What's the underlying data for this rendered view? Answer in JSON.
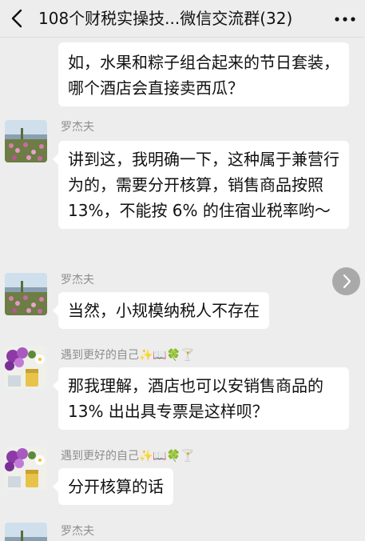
{
  "header": {
    "title": "108个财税实操技...微信交流群(32)",
    "back_icon": "chevron-left-icon",
    "more_icon": "ellipsis-icon"
  },
  "messages": [
    {
      "sender": "",
      "text": "如，水果和粽子组合起来的节日套装，哪个酒店会直接卖西瓜？",
      "avatar": ""
    },
    {
      "sender": "罗杰夫",
      "text": "讲到这，我明确一下，这种属于兼营行为的，需要分开核算，销售商品按照 13%，不能按 6% 的住宿业税率哟～",
      "avatar": "field-photo-avatar"
    },
    {
      "sender": "罗杰夫",
      "text": "当然，小规模纳税人不存在",
      "avatar": "field-photo-avatar"
    },
    {
      "sender": "遇到更好的自己✨📖🍀🍸",
      "text": "那我理解，酒店也可以安销售商品的 13% 出出具专票是这样呗？",
      "avatar": "flower-photo-avatar"
    },
    {
      "sender": "遇到更好的自己✨📖🍀🍸",
      "text": "分开核算的话",
      "avatar": "flower-photo-avatar"
    },
    {
      "sender": "罗杰夫",
      "text": "",
      "avatar": "field-photo-avatar"
    }
  ],
  "jump_button_icon": "chevron-right-icon",
  "colors": {
    "background": "#ededed",
    "bubble": "#ffffff",
    "sender_name": "#8e8e8e",
    "text": "#111111"
  }
}
